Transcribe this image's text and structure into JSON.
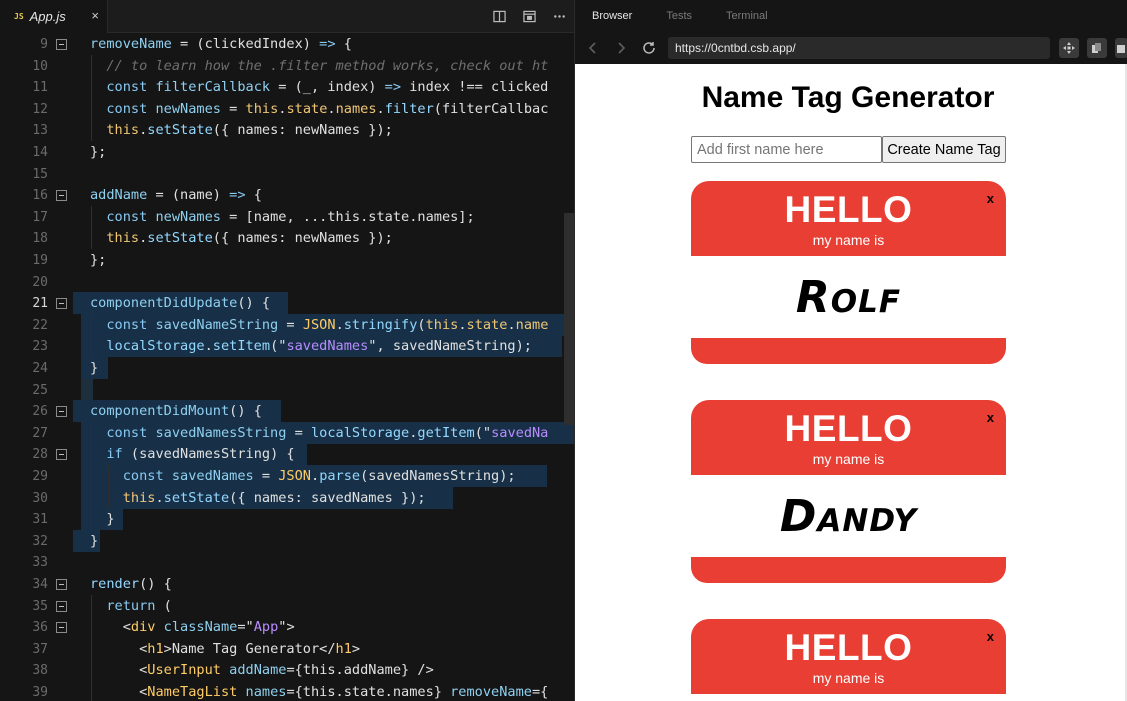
{
  "editor": {
    "tab": {
      "badge": "JS",
      "file_name": "App.js",
      "close": "×"
    },
    "lines": [
      {
        "n": "9",
        "fold": true,
        "tokens": [
          [
            "tok-prop",
            "removeName"
          ],
          [
            "tok-pl",
            " = (clickedIndex) "
          ],
          [
            "tok-kw",
            "=>"
          ],
          [
            "tok-pl",
            " {"
          ]
        ]
      },
      {
        "n": "10",
        "fold": false,
        "tokens": [
          [
            "tok-cm",
            "  // to learn how the .filter method works, check out ht"
          ]
        ]
      },
      {
        "n": "11",
        "fold": false,
        "tokens": [
          [
            "tok-kw",
            "  const "
          ],
          [
            "tok-prop",
            "filterCallback"
          ],
          [
            "tok-pl",
            " = (_, index) "
          ],
          [
            "tok-kw",
            "=>"
          ],
          [
            "tok-pl",
            " index !== clicked"
          ]
        ]
      },
      {
        "n": "12",
        "fold": false,
        "tokens": [
          [
            "tok-kw",
            "  const "
          ],
          [
            "tok-prop",
            "newNames"
          ],
          [
            "tok-pl",
            " = "
          ],
          [
            "tok-this",
            "this"
          ],
          [
            "tok-pl",
            "."
          ],
          [
            "tok-this",
            "state"
          ],
          [
            "tok-pl",
            "."
          ],
          [
            "tok-this",
            "names"
          ],
          [
            "tok-pl",
            "."
          ],
          [
            "tok-fn",
            "filter"
          ],
          [
            "tok-pl",
            "(filterCallbac"
          ]
        ]
      },
      {
        "n": "13",
        "fold": false,
        "tokens": [
          [
            "tok-this",
            "  this"
          ],
          [
            "tok-pl",
            "."
          ],
          [
            "tok-fn",
            "setState"
          ],
          [
            "tok-pl",
            "({ names: newNames });"
          ]
        ]
      },
      {
        "n": "14",
        "fold": false,
        "tokens": [
          [
            "tok-pl",
            "};"
          ]
        ]
      },
      {
        "n": "15",
        "fold": false,
        "tokens": []
      },
      {
        "n": "16",
        "fold": true,
        "tokens": [
          [
            "tok-prop",
            "addName"
          ],
          [
            "tok-pl",
            " = (name) "
          ],
          [
            "tok-kw",
            "=>"
          ],
          [
            "tok-pl",
            " {"
          ]
        ]
      },
      {
        "n": "17",
        "fold": false,
        "tokens": [
          [
            "tok-kw",
            "  const "
          ],
          [
            "tok-prop",
            "newNames"
          ],
          [
            "tok-pl",
            " = [name, ...this.state.names];"
          ]
        ]
      },
      {
        "n": "18",
        "fold": false,
        "tokens": [
          [
            "tok-this",
            "  this"
          ],
          [
            "tok-pl",
            "."
          ],
          [
            "tok-fn",
            "setState"
          ],
          [
            "tok-pl",
            "({ names: newNames });"
          ]
        ]
      },
      {
        "n": "19",
        "fold": false,
        "tokens": [
          [
            "tok-pl",
            "};"
          ]
        ]
      },
      {
        "n": "20",
        "fold": false,
        "tokens": []
      },
      {
        "n": "21",
        "fold": true,
        "active": true,
        "tokens": [
          [
            "tok-prop",
            "componentDidUpdate"
          ],
          [
            "tok-pl",
            "() {"
          ]
        ]
      },
      {
        "n": "22",
        "fold": false,
        "tokens": [
          [
            "tok-kw",
            "  const "
          ],
          [
            "tok-prop",
            "savedNameString"
          ],
          [
            "tok-pl",
            " = "
          ],
          [
            "tok-tag",
            "JSON"
          ],
          [
            "tok-pl",
            "."
          ],
          [
            "tok-fn",
            "stringify"
          ],
          [
            "tok-pl",
            "("
          ],
          [
            "tok-this",
            "this"
          ],
          [
            "tok-pl",
            "."
          ],
          [
            "tok-this",
            "state"
          ],
          [
            "tok-pl",
            "."
          ],
          [
            "tok-this",
            "name"
          ]
        ]
      },
      {
        "n": "23",
        "fold": false,
        "tokens": [
          [
            "tok-fn",
            "  localStorage"
          ],
          [
            "tok-pl",
            "."
          ],
          [
            "tok-fn",
            "setItem"
          ],
          [
            "tok-pl",
            "(\""
          ],
          [
            "tok-str",
            "savedNames"
          ],
          [
            "tok-pl",
            "\", savedNameString);"
          ]
        ]
      },
      {
        "n": "24",
        "fold": false,
        "tokens": [
          [
            "tok-pl",
            "}"
          ]
        ]
      },
      {
        "n": "25",
        "fold": false,
        "tokens": []
      },
      {
        "n": "26",
        "fold": true,
        "tokens": [
          [
            "tok-prop",
            "componentDidMount"
          ],
          [
            "tok-pl",
            "() {"
          ]
        ]
      },
      {
        "n": "27",
        "fold": false,
        "tokens": [
          [
            "tok-kw",
            "  const "
          ],
          [
            "tok-prop",
            "savedNamesString"
          ],
          [
            "tok-pl",
            " = "
          ],
          [
            "tok-fn",
            "localStorage"
          ],
          [
            "tok-pl",
            "."
          ],
          [
            "tok-fn",
            "getItem"
          ],
          [
            "tok-pl",
            "(\""
          ],
          [
            "tok-str",
            "savedNa"
          ]
        ]
      },
      {
        "n": "28",
        "fold": true,
        "tokens": [
          [
            "tok-kw",
            "  if"
          ],
          [
            "tok-pl",
            " (savedNamesString) {"
          ]
        ]
      },
      {
        "n": "29",
        "fold": false,
        "tokens": [
          [
            "tok-kw",
            "    const "
          ],
          [
            "tok-prop",
            "savedNames"
          ],
          [
            "tok-pl",
            " = "
          ],
          [
            "tok-tag",
            "JSON"
          ],
          [
            "tok-pl",
            "."
          ],
          [
            "tok-fn",
            "parse"
          ],
          [
            "tok-pl",
            "(savedNamesString);"
          ]
        ]
      },
      {
        "n": "30",
        "fold": false,
        "tokens": [
          [
            "tok-this",
            "    this"
          ],
          [
            "tok-pl",
            "."
          ],
          [
            "tok-fn",
            "setState"
          ],
          [
            "tok-pl",
            "({ names: savedNames });"
          ]
        ]
      },
      {
        "n": "31",
        "fold": false,
        "tokens": [
          [
            "tok-pl",
            "  }"
          ]
        ]
      },
      {
        "n": "32",
        "fold": false,
        "tokens": [
          [
            "tok-pl",
            "}"
          ]
        ]
      },
      {
        "n": "33",
        "fold": false,
        "tokens": []
      },
      {
        "n": "34",
        "fold": true,
        "tokens": [
          [
            "tok-fn",
            "render"
          ],
          [
            "tok-pl",
            "() {"
          ]
        ]
      },
      {
        "n": "35",
        "fold": true,
        "tokens": [
          [
            "tok-kw",
            "  return"
          ],
          [
            "tok-pl",
            " ("
          ]
        ]
      },
      {
        "n": "36",
        "fold": true,
        "tokens": [
          [
            "tok-pl",
            "    <"
          ],
          [
            "tok-tag",
            "div"
          ],
          [
            "tok-pl",
            " "
          ],
          [
            "tok-prop",
            "className"
          ],
          [
            "tok-pl",
            "=\""
          ],
          [
            "tok-str",
            "App"
          ],
          [
            "tok-pl",
            "\">"
          ]
        ]
      },
      {
        "n": "37",
        "fold": false,
        "tokens": [
          [
            "tok-pl",
            "      <"
          ],
          [
            "tok-tag",
            "h1"
          ],
          [
            "tok-pl",
            ">Name Tag Generator</"
          ],
          [
            "tok-tag",
            "h1"
          ],
          [
            "tok-pl",
            ">"
          ]
        ]
      },
      {
        "n": "38",
        "fold": false,
        "tokens": [
          [
            "tok-pl",
            "      <"
          ],
          [
            "tok-tag",
            "UserInput"
          ],
          [
            "tok-pl",
            " "
          ],
          [
            "tok-prop",
            "addName"
          ],
          [
            "tok-pl",
            "={this.addName} />"
          ]
        ]
      },
      {
        "n": "39",
        "fold": false,
        "tokens": [
          [
            "tok-pl",
            "      <"
          ],
          [
            "tok-tag",
            "NameTagList"
          ],
          [
            "tok-pl",
            " "
          ],
          [
            "tok-prop",
            "names"
          ],
          [
            "tok-pl",
            "={this.state.names} "
          ],
          [
            "tok-prop",
            "removeName"
          ],
          [
            "tok-pl",
            "={"
          ]
        ]
      }
    ]
  },
  "browser": {
    "tabs": [
      {
        "label": "Browser",
        "active": true
      },
      {
        "label": "Tests",
        "active": false
      },
      {
        "label": "Terminal",
        "active": false
      }
    ],
    "url": "https://0cntbd.csb.app/",
    "page": {
      "title": "Name Tag Generator",
      "input_placeholder": "Add first name here",
      "input_value": "",
      "button_label": "Create Name Tag",
      "nametags": [
        {
          "hello": "HELLO",
          "subtitle": "my name is",
          "name": "Rolf",
          "close": "x"
        },
        {
          "hello": "HELLO",
          "subtitle": "my name is",
          "name": "Dandy",
          "close": "x"
        },
        {
          "hello": "HELLO",
          "subtitle": "my name is",
          "name": "",
          "close": "x"
        }
      ]
    }
  }
}
